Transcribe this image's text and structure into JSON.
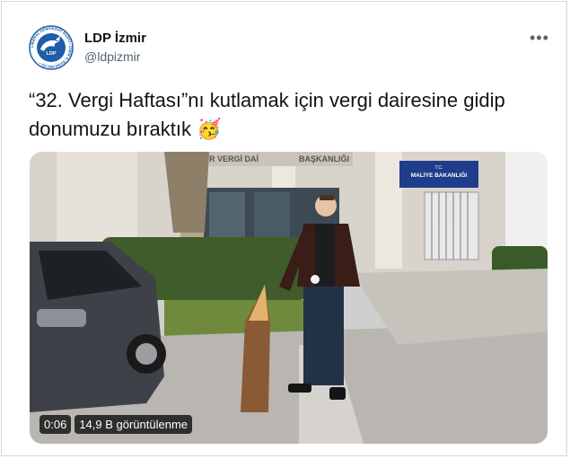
{
  "tweet": {
    "author_name": "LDP İzmir",
    "author_handle": "@ldpizmir",
    "more_icon": "more-dots-icon",
    "text": "“32. Vergi Haftası”nı kutlamak için vergi dairesine gidip donumuzu bıraktık 🥳"
  },
  "avatar": {
    "ring_text": "LİBERAL DEMOKRAT PARTİ • İZMİR İL BAŞKANLIĞI •",
    "center_text": "LDP",
    "brand_color": "#1e5ea8"
  },
  "scene": {
    "sign_left": "İZMİR VERGİ DAİ",
    "sign_right": "BAŞKANLIĞI",
    "blue_sign_line1": "T.C.",
    "blue_sign_line2": "MALİYE BAKANLIĞI"
  },
  "video": {
    "time": "0:06",
    "views": "14,9 B görüntülenme"
  }
}
